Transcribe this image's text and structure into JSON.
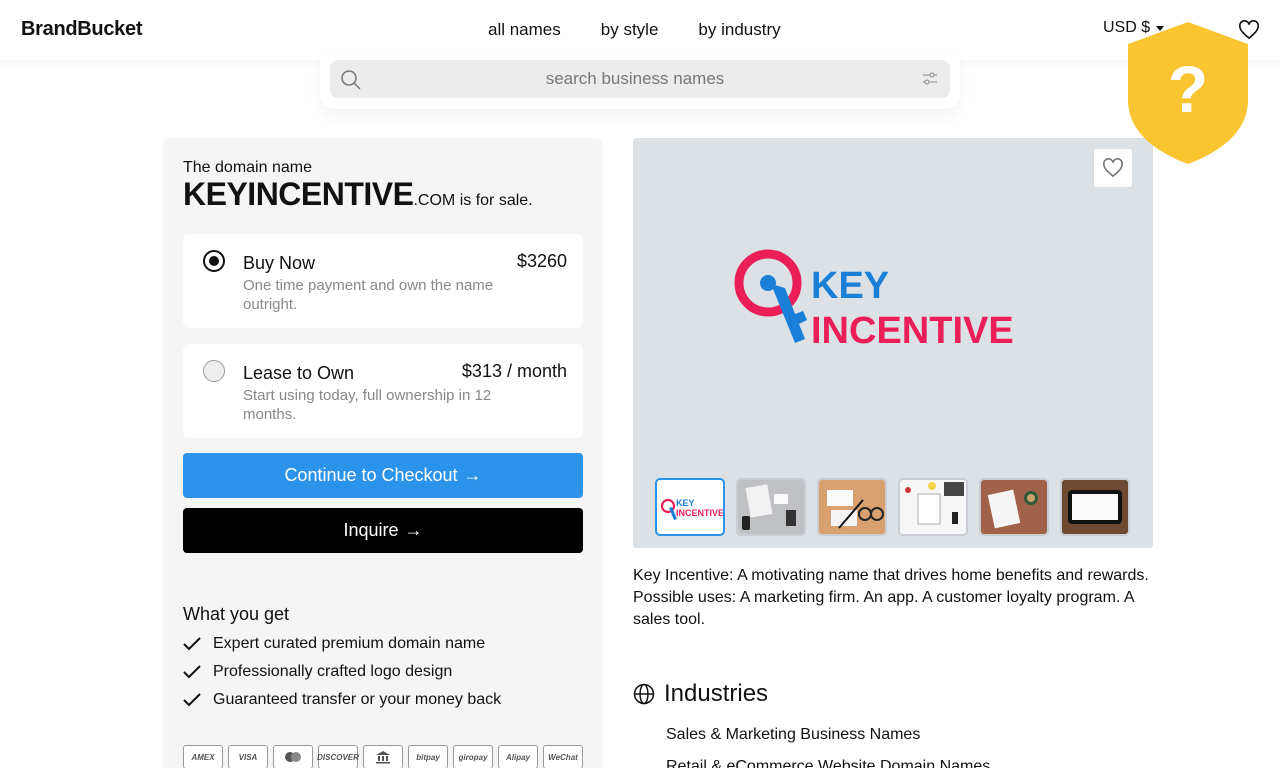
{
  "header": {
    "logo": "BrandBucket",
    "nav": [
      "all names",
      "by style",
      "by industry"
    ],
    "currency": "USD $",
    "favorites_icon": "heart-icon"
  },
  "search": {
    "placeholder": "search business names",
    "icon": "search-icon",
    "filter_icon": "sliders-icon"
  },
  "listing": {
    "intro": "The domain name",
    "domain": "KEYINCENTIVE",
    "tld": ".COM",
    "suffix": " is for sale.",
    "options": [
      {
        "title": "Buy Now",
        "price": "$3260",
        "desc": "One time payment and own the name outright.",
        "selected": true
      },
      {
        "title": "Lease to Own",
        "price": "$313 / month",
        "desc": "Start using today, full ownership in 12 months.",
        "selected": false
      }
    ],
    "checkout_label": "Continue to Checkout",
    "inquire_label": "Inquire",
    "arrow": "→"
  },
  "what_you_get": {
    "title": "What you get",
    "items": [
      "Expert curated premium domain name",
      "Professionally crafted logo design",
      "Guaranteed transfer or your money back"
    ]
  },
  "payments": [
    "AMEX",
    "VISA",
    "mastercard",
    "DISCOVER",
    "bank",
    "bitpay",
    "giropay",
    "Alipay",
    "WeChat"
  ],
  "preview": {
    "logo_line1": "KEY",
    "logo_line2": "INCENTIVE",
    "thumb_line1": "KEY",
    "thumb_line2": "INCENTIVE",
    "colors": {
      "blue": "#1a7fd6",
      "pink": "#ea1f5a",
      "bg": "#dce1e6"
    }
  },
  "description": "Key Incentive: A motivating name that drives home benefits and rewards. Possible uses: A marketing firm. An app. A customer loyalty program. A sales tool.",
  "industries": {
    "heading": "Industries",
    "items": [
      "Sales & Marketing Business Names",
      "Retail & eCommerce Website Domain Names"
    ]
  },
  "badge": {
    "glyph": "?",
    "color": "#fbc531"
  }
}
